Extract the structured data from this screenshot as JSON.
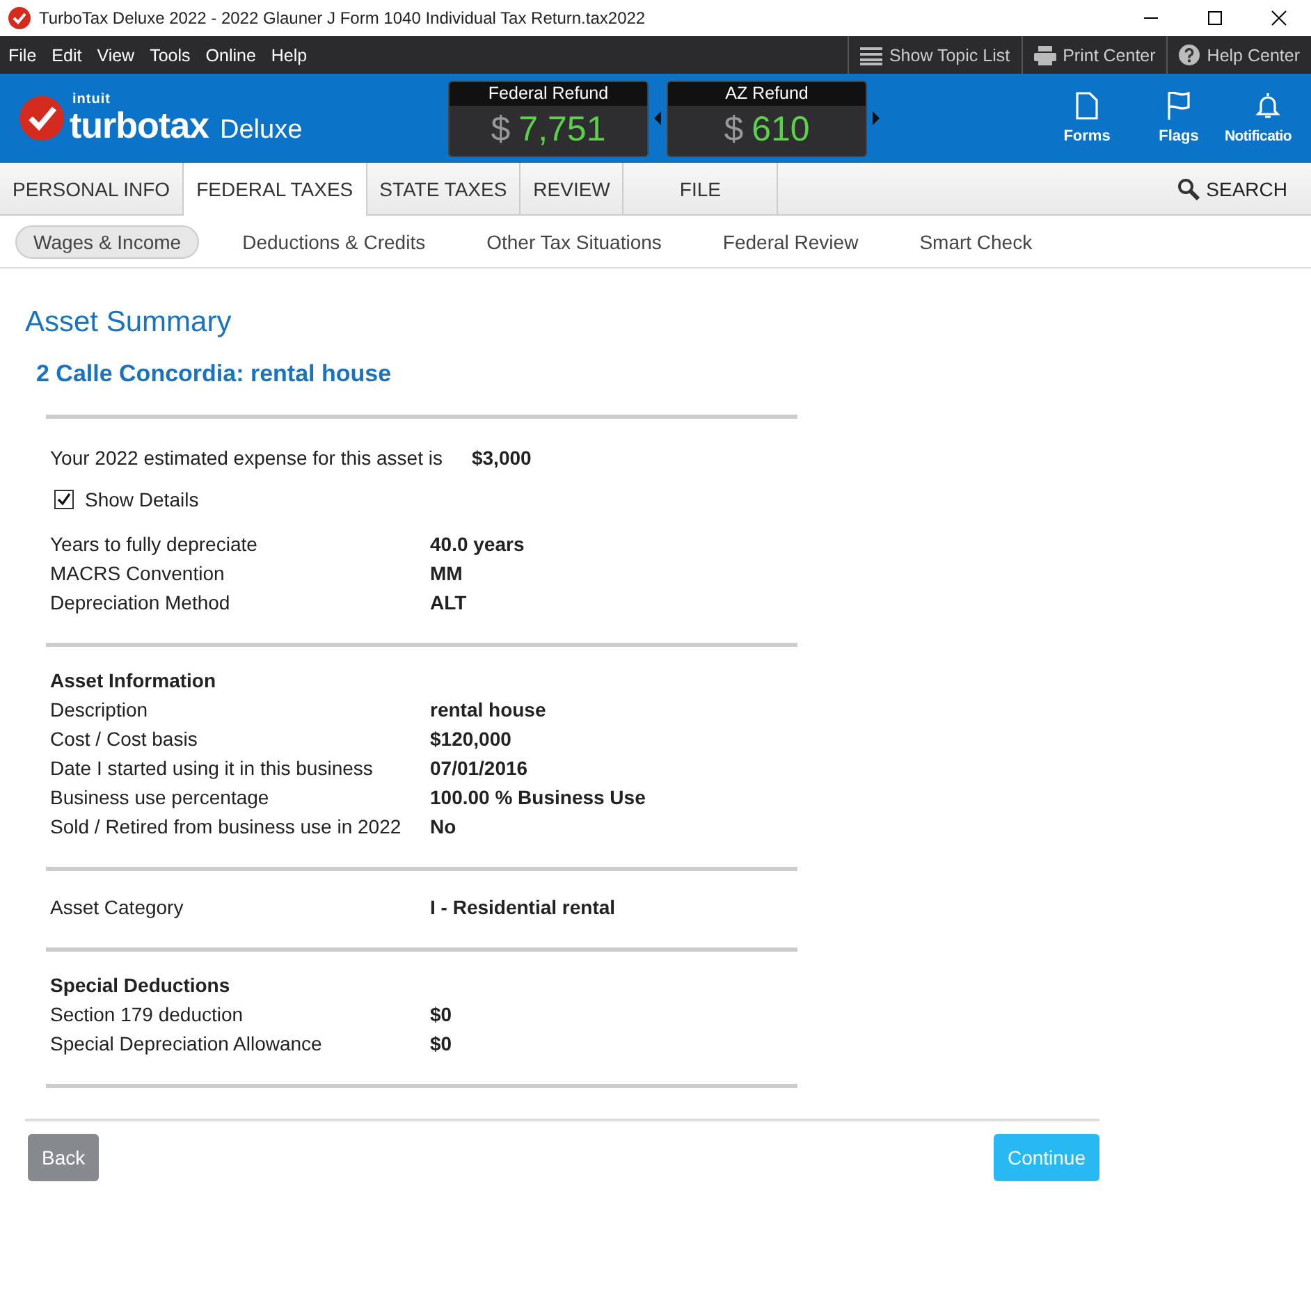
{
  "window": {
    "title": "TurboTax Deluxe 2022 - 2022 Glauner J Form 1040  Individual Tax Return.tax2022"
  },
  "menu": [
    "File",
    "Edit",
    "View",
    "Tools",
    "Online",
    "Help"
  ],
  "menu_tools": [
    {
      "kind": "topics",
      "label": "Show Topic List"
    },
    {
      "kind": "print",
      "label": "Print Center"
    },
    {
      "kind": "help",
      "label": "Help Center"
    }
  ],
  "header": {
    "brand": "intuit",
    "product": "turbotax",
    "edition": "Deluxe",
    "refunds": [
      {
        "label": "Federal Refund",
        "currency": "$",
        "amount": "7,751"
      },
      {
        "label": "AZ Refund",
        "currency": "$",
        "amount": "610"
      }
    ],
    "actions": [
      {
        "kind": "forms",
        "label": "Forms"
      },
      {
        "kind": "flags",
        "label": "Flags"
      },
      {
        "kind": "bell",
        "label": "Notificatio"
      }
    ]
  },
  "tabs": [
    {
      "label": "PERSONAL INFO",
      "selected": false
    },
    {
      "label": "FEDERAL TAXES",
      "selected": true
    },
    {
      "label": "STATE TAXES",
      "selected": false
    },
    {
      "label": "REVIEW",
      "selected": false
    },
    {
      "label": "FILE",
      "selected": false
    }
  ],
  "search": {
    "label": "SEARCH"
  },
  "subtabs": [
    {
      "label": "Wages & Income",
      "selected": true
    },
    {
      "label": "Deductions & Credits",
      "selected": false
    },
    {
      "label": "Other Tax Situations",
      "selected": false
    },
    {
      "label": "Federal Review",
      "selected": false
    },
    {
      "label": "Smart Check",
      "selected": false
    }
  ],
  "page_title": "Asset Summary",
  "asset_title": "2 Calle Concordia: rental house",
  "expense": {
    "label": "Your 2022 estimated expense for this asset is",
    "value": "$3,000"
  },
  "show_details": {
    "label": "Show Details",
    "checked": true
  },
  "sections": [
    {
      "rows": [
        {
          "label": "Years to fully depreciate",
          "value": "40.0 years"
        },
        {
          "label": "MACRS Convention",
          "value": "MM"
        },
        {
          "label": "Depreciation Method",
          "value": "ALT"
        }
      ]
    },
    {
      "heading": "Asset Information",
      "rows": [
        {
          "label": "Description",
          "value": "rental house"
        },
        {
          "label": "Cost / Cost basis",
          "value": "$120,000"
        },
        {
          "label": "Date I started using it in this business",
          "value": "07/01/2016"
        },
        {
          "label": "Business use percentage",
          "value": "100.00 % Business Use"
        },
        {
          "label": "Sold / Retired from business use in 2022",
          "value": "No"
        }
      ]
    },
    {
      "rows": [
        {
          "label": "Asset Category",
          "value": "I - Residential rental"
        }
      ]
    },
    {
      "heading": "Special Deductions",
      "rows": [
        {
          "label": "Section 179 deduction",
          "value": "$0"
        },
        {
          "label": "Special Depreciation Allowance",
          "value": "$0"
        }
      ]
    }
  ],
  "buttons": {
    "back": "Back",
    "continue": "Continue"
  }
}
